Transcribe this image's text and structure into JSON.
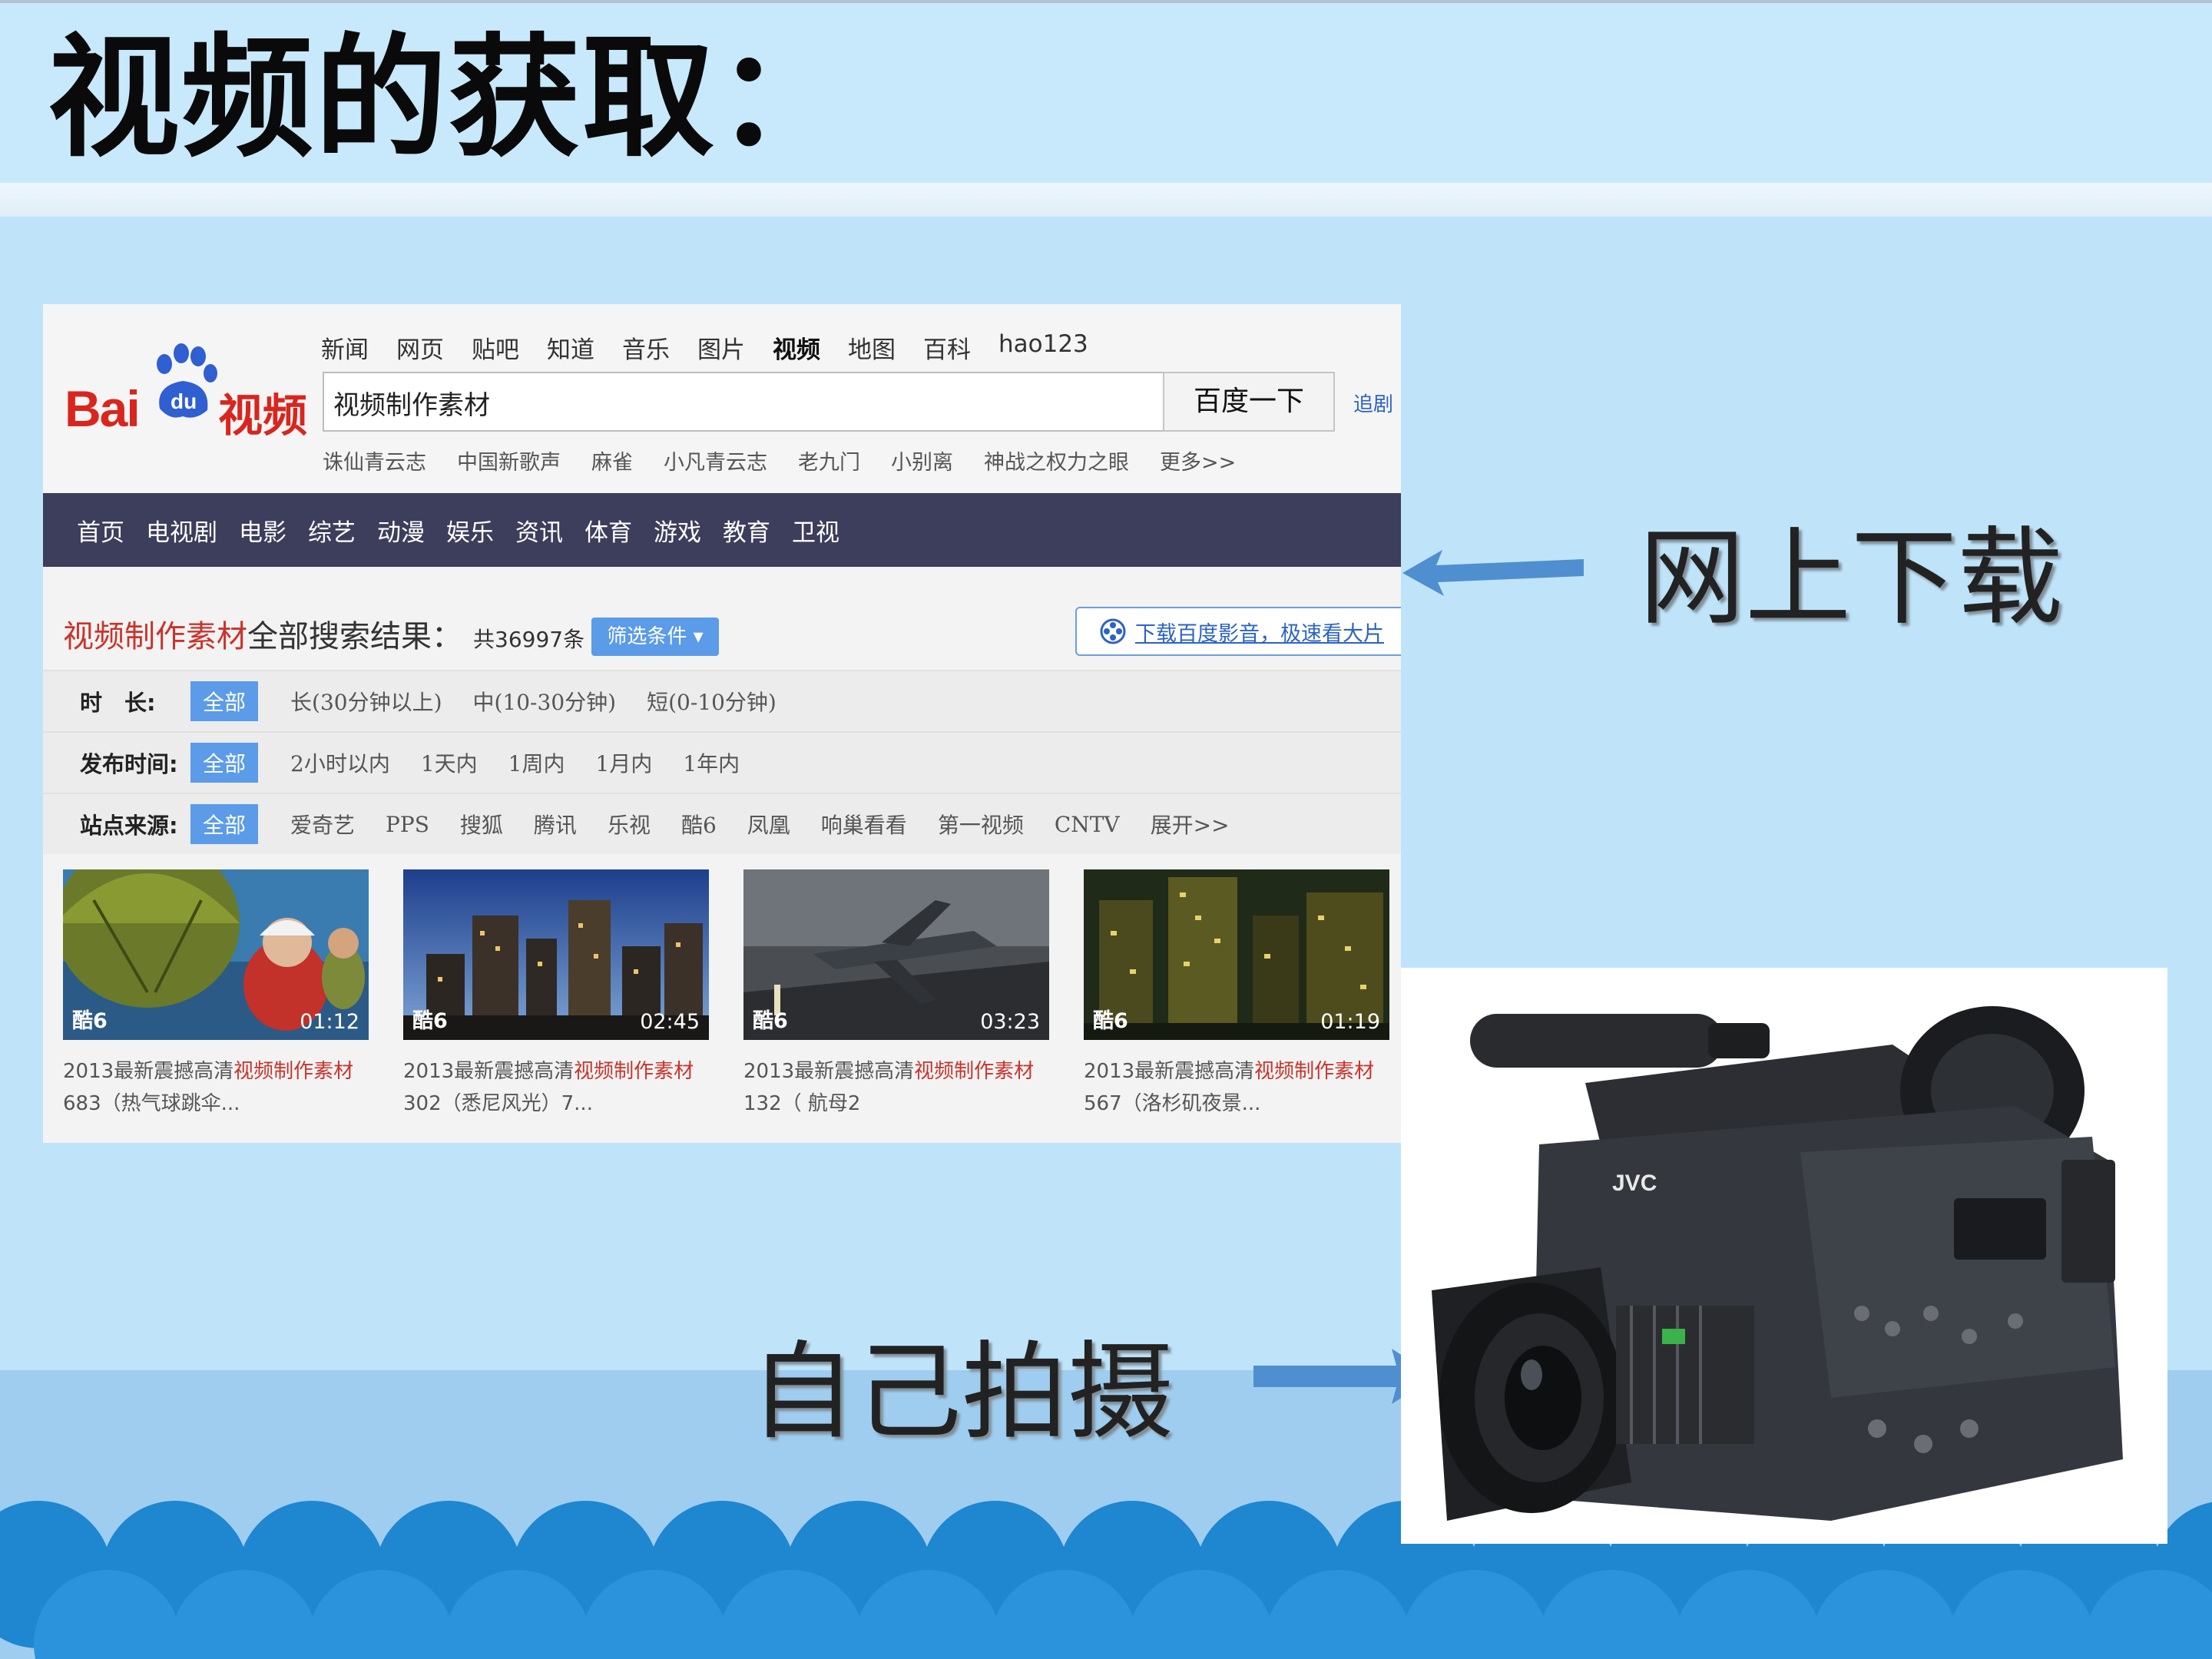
{
  "slide": {
    "title": "视频的获取：",
    "label_download": "网上下载",
    "label_shoot": "自己拍摄"
  },
  "baidu": {
    "logo_bai": "Bai",
    "logo_du": "du",
    "logo_video": "视频",
    "top_nav": [
      "新闻",
      "网页",
      "贴吧",
      "知道",
      "音乐",
      "图片",
      "视频",
      "地图",
      "百科",
      "hao123"
    ],
    "top_nav_active": "视频",
    "search_value": "视频制作素材",
    "search_button": "百度一下",
    "search_extra": "追剧",
    "hot_words": [
      "诛仙青云志",
      "中国新歌声",
      "麻雀",
      "小凡青云志",
      "老九门",
      "小别离",
      "神战之权力之眼",
      "更多>>"
    ],
    "channels": [
      "首页",
      "电视剧",
      "电影",
      "综艺",
      "动漫",
      "娱乐",
      "资讯",
      "体育",
      "游戏",
      "教育",
      "卫视"
    ],
    "result_query": "视频制作素材",
    "result_text": "全部搜索结果：",
    "result_count": "共36997条",
    "filter_button": "筛选条件",
    "download_banner": "下载百度影音，极速看大片",
    "filters": [
      {
        "label": "时　长:",
        "all": "全部",
        "options": [
          "长(30分钟以上)",
          "中(10-30分钟)",
          "短(0-10分钟)"
        ]
      },
      {
        "label": "发布时间:",
        "all": "全部",
        "options": [
          "2小时以内",
          "1天内",
          "1周内",
          "1月内",
          "1年内"
        ]
      },
      {
        "label": "站点来源:",
        "all": "全部",
        "options": [
          "爱奇艺",
          "PPS",
          "搜狐",
          "腾讯",
          "乐视",
          "酷6",
          "凤凰",
          "响巢看看",
          "第一视频",
          "CNTV",
          "展开>>"
        ]
      }
    ],
    "videos": [
      {
        "source": "酷6",
        "duration": "01:12",
        "title_prefix": "2013最新震撼高清",
        "title_keyword": "视频制作素材",
        "title_line2": "683（热气球跳伞..."
      },
      {
        "source": "酷6",
        "duration": "02:45",
        "title_prefix": "2013最新震撼高清",
        "title_keyword": "视频制作素材",
        "title_line2": "302（悉尼风光）7..."
      },
      {
        "source": "酷6",
        "duration": "03:23",
        "title_prefix": "2013最新震撼高清",
        "title_keyword": "视频制作素材",
        "title_line2": "132（ 航母2"
      },
      {
        "source": "酷6",
        "duration": "01:19",
        "title_prefix": "2013最新震撼高清",
        "title_keyword": "视频制作素材",
        "title_line2": "567（洛杉矶夜景..."
      }
    ],
    "colors": {
      "brand_red": "#d8261e",
      "channel_bar": "#3d3d5c",
      "link_blue": "#2c63c4",
      "chip_blue": "#5b9be8"
    }
  },
  "camera": {
    "brand": "JVC"
  }
}
